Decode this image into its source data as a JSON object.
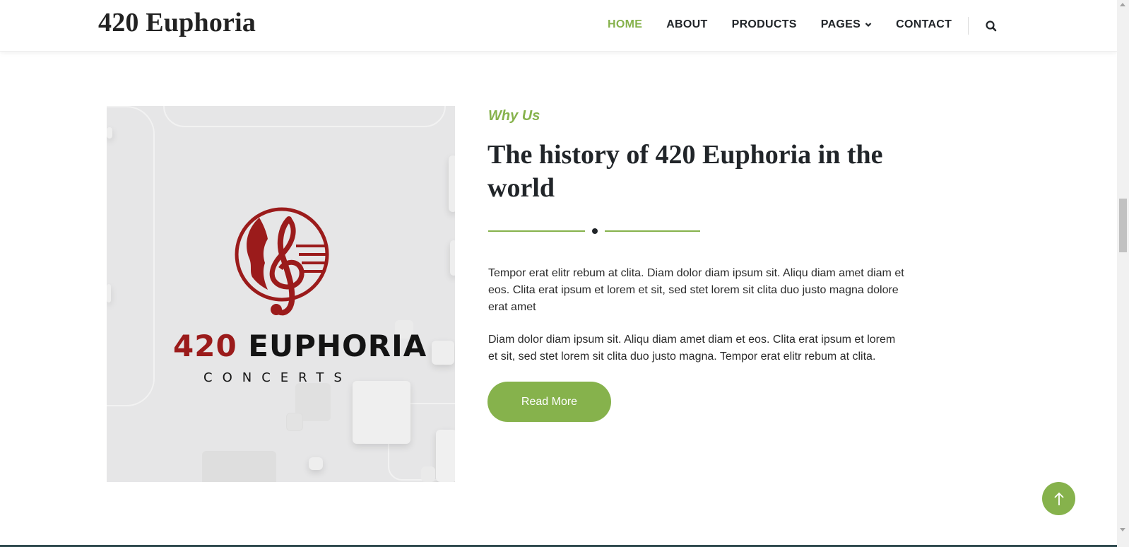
{
  "header": {
    "brand": "420 Euphoria",
    "nav": [
      {
        "label": "HOME",
        "active": true
      },
      {
        "label": "ABOUT",
        "active": false
      },
      {
        "label": "PRODUCTS",
        "active": false
      },
      {
        "label": "PAGES",
        "active": false,
        "has_dropdown": true
      },
      {
        "label": "CONTACT",
        "active": false
      }
    ],
    "search_icon": "search-icon"
  },
  "about": {
    "image": {
      "logo_number": "420",
      "logo_word": "EUPHORIA",
      "logo_sub": "CONCERTS"
    },
    "eyebrow": "Why Us",
    "headline": "The history of 420 Euphoria in the world",
    "paragraphs": [
      "Tempor erat elitr rebum at clita. Diam dolor diam ipsum sit. Aliqu diam amet diam et eos. Clita erat ipsum et lorem et sit, sed stet lorem sit clita duo justo magna dolore erat amet",
      "Diam dolor diam ipsum sit. Aliqu diam amet diam et eos. Clita erat ipsum et lorem et sit, sed stet lorem sit clita duo justo magna. Tempor erat elitr rebum at clita."
    ],
    "button": "Read More"
  },
  "colors": {
    "accent": "#86b24c",
    "text": "#212529",
    "logo_red": "#9b1b1b"
  },
  "back_to_top_icon": "arrow-up-icon"
}
